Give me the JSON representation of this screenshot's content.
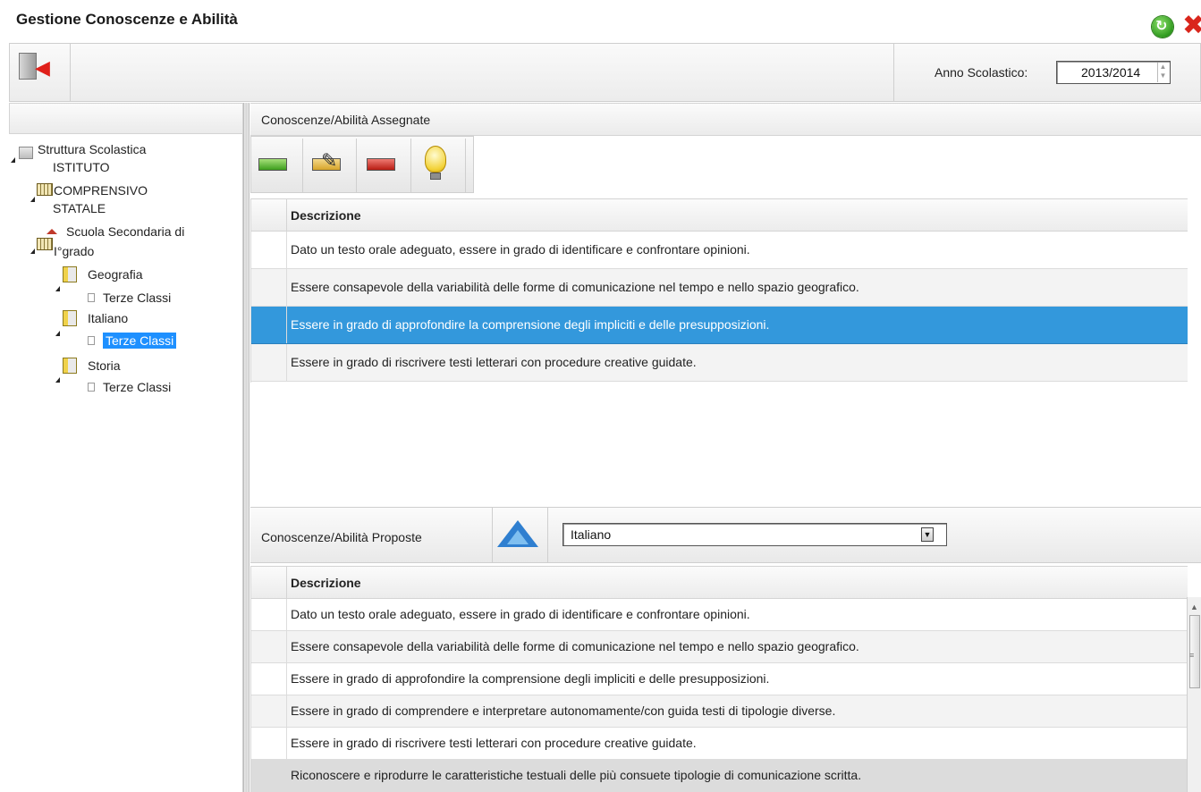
{
  "window": {
    "title": "Gestione Conoscenze e Abilità"
  },
  "toolbar": {
    "year_label": "Anno Scolastico:",
    "year_value": "2013/2014"
  },
  "tree": {
    "root": "Struttura Scolastica",
    "institute_line1": "ISTITUTO",
    "institute_line2": "COMPRENSIVO",
    "institute_line3": "STATALE",
    "school_line1": "Scuola Secondaria di",
    "school_line2": "I°grado",
    "subjects": [
      {
        "name": "Geografia",
        "child": "Terze Classi"
      },
      {
        "name": "Italiano",
        "child": "Terze Classi"
      },
      {
        "name": "Storia",
        "child": "Terze Classi"
      }
    ]
  },
  "assigned": {
    "header": "Conoscenze/Abilità Assegnate",
    "column": "Descrizione",
    "rows": [
      "Dato un testo orale adeguato, essere in grado di identificare e confrontare opinioni.",
      "Essere consapevole della variabilità delle forme di comunicazione nel tempo e nello spazio geografico.",
      "Essere in grado di approfondire la comprensione degli impliciti e delle presupposizioni.",
      "Essere in grado di riscrivere testi letterari con procedure creative guidate."
    ]
  },
  "proposed": {
    "header": "Conoscenze/Abilità Proposte",
    "select_value": "Italiano",
    "column": "Descrizione",
    "rows": [
      "Dato un testo orale adeguato, essere in grado di identificare e confrontare opinioni.",
      "Essere consapevole della variabilità delle forme di comunicazione nel tempo e nello spazio geografico.",
      "Essere in grado di approfondire la comprensione degli impliciti e delle presupposizioni.",
      "Essere in grado di comprendere e interpretare autonomamente/con guida testi di tipologie diverse.",
      "Essere in grado di riscrivere testi letterari con procedure creative guidate.",
      "Riconoscere e riprodurre le caratteristiche testuali delle più consuete tipologie di comunicazione scritta."
    ]
  },
  "colors": {
    "selection": "#3398dc",
    "tree_selection": "#1e90ff"
  }
}
